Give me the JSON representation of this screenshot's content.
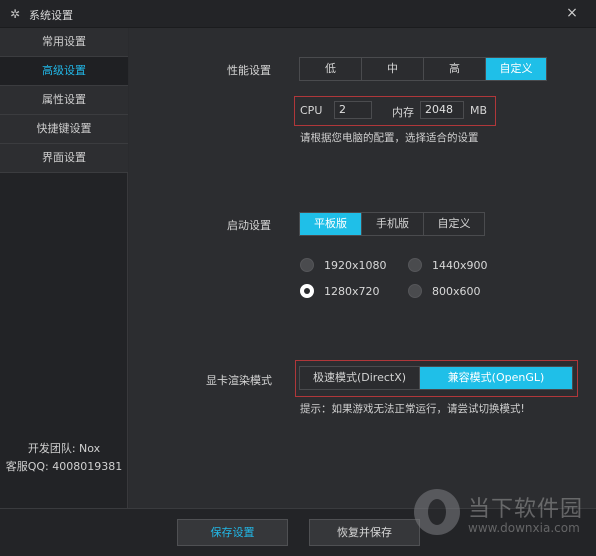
{
  "window": {
    "title": "系统设置",
    "close_symbol": "×"
  },
  "sidebar": {
    "items": [
      {
        "label": "常用设置",
        "active": false
      },
      {
        "label": "高级设置",
        "active": true
      },
      {
        "label": "属性设置",
        "active": false
      },
      {
        "label": "快捷键设置",
        "active": false
      },
      {
        "label": "界面设置",
        "active": false
      }
    ],
    "team": "开发团队: Nox",
    "support": "客服QQ: 4008019381"
  },
  "performance": {
    "label": "性能设置",
    "options": [
      "低",
      "中",
      "高",
      "自定义"
    ],
    "selected": "自定义",
    "cpu_label": "CPU",
    "cpu_value": "2",
    "memory_label": "内存",
    "memory_value": "2048",
    "memory_unit": "MB",
    "hint": "请根据您电脑的配置，选择适合的设置"
  },
  "startup": {
    "label": "启动设置",
    "options": [
      "平板版",
      "手机版",
      "自定义"
    ],
    "selected": "平板版",
    "resolutions": [
      {
        "label": "1920x1080",
        "checked": false
      },
      {
        "label": "1440x900",
        "checked": false
      },
      {
        "label": "1280x720",
        "checked": true
      },
      {
        "label": "800x600",
        "checked": false
      }
    ]
  },
  "render": {
    "label": "显卡渲染模式",
    "options": [
      "极速模式(DirectX)",
      "兼容模式(OpenGL)"
    ],
    "selected": "兼容模式(OpenGL)",
    "hint": "提示：如果游戏无法正常运行，请尝试切换模式!"
  },
  "footer": {
    "save_label": "保存设置",
    "restore_label": "恢复并保存",
    "save_color": "#22b8e8",
    "restore_color": "#d8d8d8"
  },
  "watermark": {
    "name": "当下软件园",
    "url": "www.downxia.com"
  },
  "colors": {
    "accent": "#1fbfe8",
    "highlight_box": "#b0373a",
    "background": "#2c2d30"
  }
}
